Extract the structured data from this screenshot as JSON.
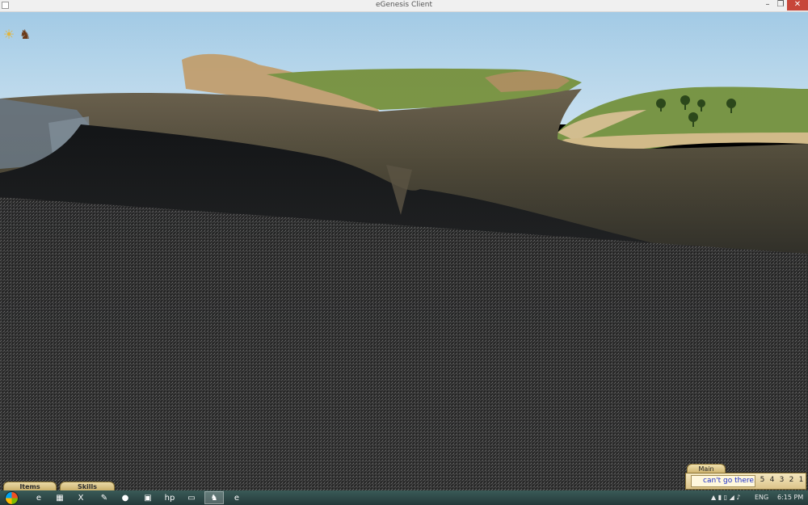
{
  "window": {
    "title": "eGenesis Client",
    "controls": {
      "minimize": "–",
      "maximize": "❐",
      "close": "✕"
    }
  },
  "hud": {
    "icons": [
      {
        "name": "sun-icon",
        "glyph": "☀"
      },
      {
        "name": "knight-icon",
        "glyph": "♞"
      }
    ]
  },
  "bottom_tabs": [
    {
      "label": "Items"
    },
    {
      "label": "Skills"
    }
  ],
  "chat": {
    "tab_label": "Main",
    "message": "can't go there.",
    "numbers": [
      "5",
      "4",
      "3",
      "2",
      "1"
    ]
  },
  "taskbar": {
    "start_icon": "windows-orb-icon",
    "apps": [
      {
        "name": "ie-icon",
        "glyph": "e"
      },
      {
        "name": "explorer-icon",
        "glyph": "▦"
      },
      {
        "name": "excel-icon",
        "glyph": "X"
      },
      {
        "name": "paint-icon",
        "glyph": "✎"
      },
      {
        "name": "norton-icon",
        "glyph": "●"
      },
      {
        "name": "app-icon",
        "glyph": "▣"
      },
      {
        "name": "hp-icon",
        "glyph": "hp"
      },
      {
        "name": "window-icon",
        "glyph": "▭"
      },
      {
        "name": "egenesis-icon",
        "glyph": "♞"
      },
      {
        "name": "browser-icon",
        "glyph": "e"
      }
    ],
    "tray": {
      "language": "ENG",
      "time": "6:15 PM"
    }
  },
  "colors": {
    "sky": "#b8dcf3",
    "tab_tan": "#dcc48a",
    "chat_text": "#1d2fc7",
    "taskbar": "#2e4848"
  }
}
